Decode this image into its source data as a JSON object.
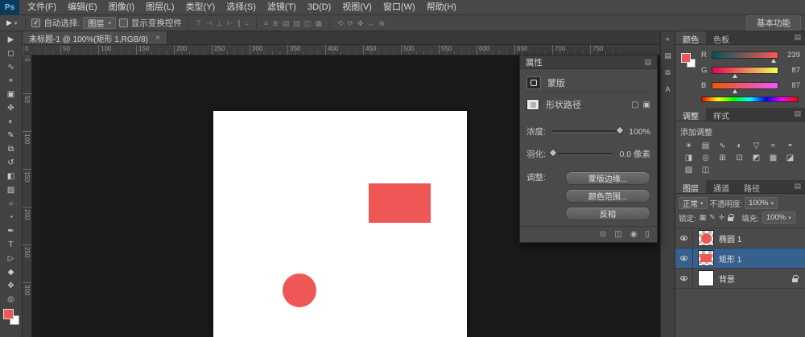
{
  "app": {
    "logo_text": "Ps",
    "accent_color": "#EF5757",
    "selected_layer_color": "#36618E"
  },
  "icons": {
    "caret_down": "▾",
    "panel_menu": "▤",
    "collapse_right": "«",
    "check": "✓",
    "close": "×"
  },
  "menubar": {
    "items": [
      "文件(F)",
      "编辑(E)",
      "图像(I)",
      "图层(L)",
      "类型(Y)",
      "选择(S)",
      "滤镜(T)",
      "3D(D)",
      "视图(V)",
      "窗口(W)",
      "帮助(H)"
    ]
  },
  "optionsbar": {
    "tool_glyph": "▶",
    "auto_select_label": "自动选择:",
    "target_dropdown": "图层",
    "show_transform_label": "显示变换控件",
    "align_icons": [
      {
        "name": "align-top-edges-icon",
        "glyph": "⊤"
      },
      {
        "name": "align-vertical-centers-icon",
        "glyph": "⊣"
      },
      {
        "name": "align-bottom-edges-icon",
        "glyph": "⊥"
      },
      {
        "name": "align-left-edges-icon",
        "glyph": "⊢"
      },
      {
        "name": "align-horizontal-centers-icon",
        "glyph": "∥"
      },
      {
        "name": "align-right-edges-icon",
        "glyph": "="
      }
    ],
    "distribute_icons": [
      {
        "name": "distribute-top-edges-icon",
        "glyph": "≡"
      },
      {
        "name": "distribute-vertical-centers-icon",
        "glyph": "≣"
      },
      {
        "name": "distribute-bottom-edges-icon",
        "glyph": "▤"
      },
      {
        "name": "distribute-left-edges-icon",
        "glyph": "▥"
      },
      {
        "name": "distribute-horizontal-centers-icon",
        "glyph": "◫"
      },
      {
        "name": "distribute-right-edges-icon",
        "glyph": "▦"
      }
    ],
    "threed_icons": [
      {
        "name": "3d-rotate-icon",
        "glyph": "⟲"
      },
      {
        "name": "3d-roll-icon",
        "glyph": "⟳"
      },
      {
        "name": "3d-drag-icon",
        "glyph": "✥"
      },
      {
        "name": "3d-slide-icon",
        "glyph": "↔"
      },
      {
        "name": "3d-scale-icon",
        "glyph": "⊕"
      }
    ],
    "workspace_button": "基本功能"
  },
  "doc_tab": {
    "title": "未标题-1 @ 100%(矩形 1,RGB/8)"
  },
  "ruler": {
    "h_ticks": [
      "0",
      "50",
      "100",
      "150",
      "200",
      "250",
      "300",
      "350",
      "400",
      "450",
      "500",
      "550",
      "600",
      "650",
      "700",
      "750"
    ],
    "v_ticks": [
      "0",
      "50",
      "100",
      "150",
      "200",
      "250",
      "300"
    ]
  },
  "toolbar": {
    "tools": [
      {
        "name": "move-tool-icon",
        "glyph": "▶"
      },
      {
        "name": "marquee-tool-icon",
        "glyph": "◻"
      },
      {
        "name": "lasso-tool-icon",
        "glyph": "∿"
      },
      {
        "name": "quick-selection-tool-icon",
        "glyph": "⌖"
      },
      {
        "name": "crop-tool-icon",
        "glyph": "▣"
      },
      {
        "name": "eyedropper-tool-icon",
        "glyph": "✜"
      },
      {
        "name": "healing-brush-tool-icon",
        "glyph": "◐"
      },
      {
        "name": "brush-tool-icon",
        "glyph": "✎"
      },
      {
        "name": "clone-stamp-tool-icon",
        "glyph": "⧉"
      },
      {
        "name": "history-brush-tool-icon",
        "glyph": "↺"
      },
      {
        "name": "eraser-tool-icon",
        "glyph": "◧"
      },
      {
        "name": "gradient-tool-icon",
        "glyph": "▨"
      },
      {
        "name": "blur-tool-icon",
        "glyph": "○"
      },
      {
        "name": "dodge-tool-icon",
        "glyph": "◔"
      },
      {
        "name": "pen-tool-icon",
        "glyph": "✒"
      },
      {
        "name": "type-tool-icon",
        "glyph": "T"
      },
      {
        "name": "path-selection-tool-icon",
        "glyph": "▷"
      },
      {
        "name": "shape-tool-icon",
        "glyph": "◆"
      },
      {
        "name": "hand-tool-icon",
        "glyph": "✥"
      },
      {
        "name": "zoom-tool-icon",
        "glyph": "◎"
      }
    ]
  },
  "properties_panel": {
    "title": "属性",
    "mask_label": "蒙版",
    "shape_path_label": "形状路径",
    "mask_buttons": [
      {
        "name": "add-pixel-mask-icon",
        "glyph": "▢"
      },
      {
        "name": "add-vector-mask-icon",
        "glyph": "▣"
      }
    ],
    "density_label": "浓度:",
    "density_value": "100%",
    "feather_label": "羽化:",
    "feather_value": "0.0 像素",
    "adjust_label": "调整:",
    "buttons": [
      "蒙版边缘...",
      "颜色范围...",
      "反相"
    ],
    "footer_icons": [
      {
        "name": "load-selection-icon",
        "glyph": "⊙"
      },
      {
        "name": "apply-mask-icon",
        "glyph": "◫"
      },
      {
        "name": "mask-visibility-icon",
        "glyph": "◉"
      },
      {
        "name": "delete-mask-icon",
        "glyph": "▯"
      }
    ]
  },
  "dock_strip": {
    "buttons": [
      {
        "name": "history-panel-icon",
        "glyph": "▤"
      },
      {
        "name": "info-panel-icon",
        "glyph": "⧉"
      },
      {
        "name": "character-panel-icon",
        "glyph": "A"
      }
    ]
  },
  "color_panel": {
    "tabs": [
      "颜色",
      "色板"
    ],
    "channels": [
      {
        "label": "R",
        "value": "239",
        "track_from": "#005757",
        "track_to": "#FF5757",
        "knob_percent": 94
      },
      {
        "label": "G",
        "value": "87",
        "track_from": "#EF0057",
        "track_to": "#EFFF57",
        "knob_percent": 34
      },
      {
        "label": "B",
        "value": "87",
        "track_from": "#EF5700",
        "track_to": "#EF57FF",
        "knob_percent": 34
      }
    ]
  },
  "adjustments_panel": {
    "tabs": [
      "调整",
      "样式"
    ],
    "hint": "添加调整",
    "icons": [
      {
        "name": "brightness-contrast-icon",
        "glyph": "☀"
      },
      {
        "name": "levels-icon",
        "glyph": "▤"
      },
      {
        "name": "curves-icon",
        "glyph": "∿"
      },
      {
        "name": "exposure-icon",
        "glyph": "◐"
      },
      {
        "name": "vibrance-icon",
        "glyph": "▽"
      },
      {
        "name": "hue-saturation-icon",
        "glyph": "≈"
      },
      {
        "name": "color-balance-icon",
        "glyph": "◓"
      },
      {
        "name": "black-white-icon",
        "glyph": "◨"
      },
      {
        "name": "photo-filter-icon",
        "glyph": "◎"
      },
      {
        "name": "channel-mixer-icon",
        "glyph": "⊞"
      },
      {
        "name": "color-lookup-icon",
        "glyph": "⊡"
      },
      {
        "name": "invert-icon",
        "glyph": "◩"
      },
      {
        "name": "posterize-icon",
        "glyph": "▦"
      },
      {
        "name": "threshold-icon",
        "glyph": "◪"
      },
      {
        "name": "gradient-map-icon",
        "glyph": "▧"
      },
      {
        "name": "selective-color-icon",
        "glyph": "◫"
      }
    ]
  },
  "layers_panel": {
    "tabs": [
      "图层",
      "通道",
      "路径"
    ],
    "blend_mode": "正常",
    "opacity_label": "不透明度:",
    "opacity_value": "100%",
    "lock_label": "锁定:",
    "lock_icons": [
      {
        "name": "lock-transparency-icon",
        "glyph": "▦"
      },
      {
        "name": "lock-pixels-icon",
        "glyph": "✎"
      },
      {
        "name": "lock-position-icon",
        "glyph": "✛"
      }
    ],
    "fill_label": "填充:",
    "fill_value": "100%",
    "layers": [
      {
        "name": "椭圆 1"
      },
      {
        "name": "矩形 1"
      },
      {
        "name": "背景"
      }
    ]
  }
}
